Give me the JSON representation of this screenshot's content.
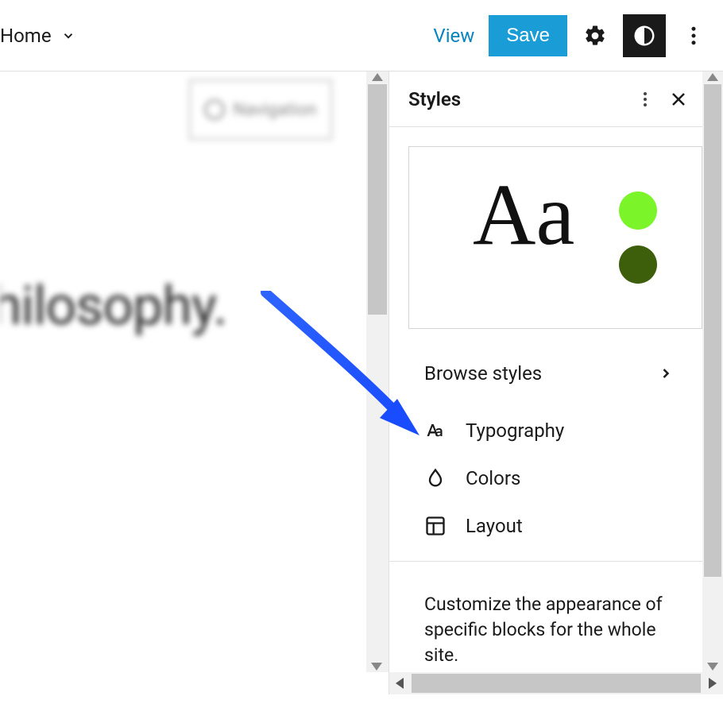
{
  "topbar": {
    "home_label": "Home",
    "view_label": "View",
    "save_label": "Save"
  },
  "canvas": {
    "nav_block_label": "Navigation",
    "heading_fragment": "hilosophy."
  },
  "panel": {
    "title": "Styles",
    "preview_text": "Aa",
    "swatch_colors": {
      "primary": "#7bf52a",
      "secondary": "#3d5e0a"
    },
    "browse_label": "Browse styles",
    "options": {
      "typography": "Typography",
      "colors": "Colors",
      "layout": "Layout"
    },
    "description": "Customize the appearance of specific blocks for the whole site."
  }
}
